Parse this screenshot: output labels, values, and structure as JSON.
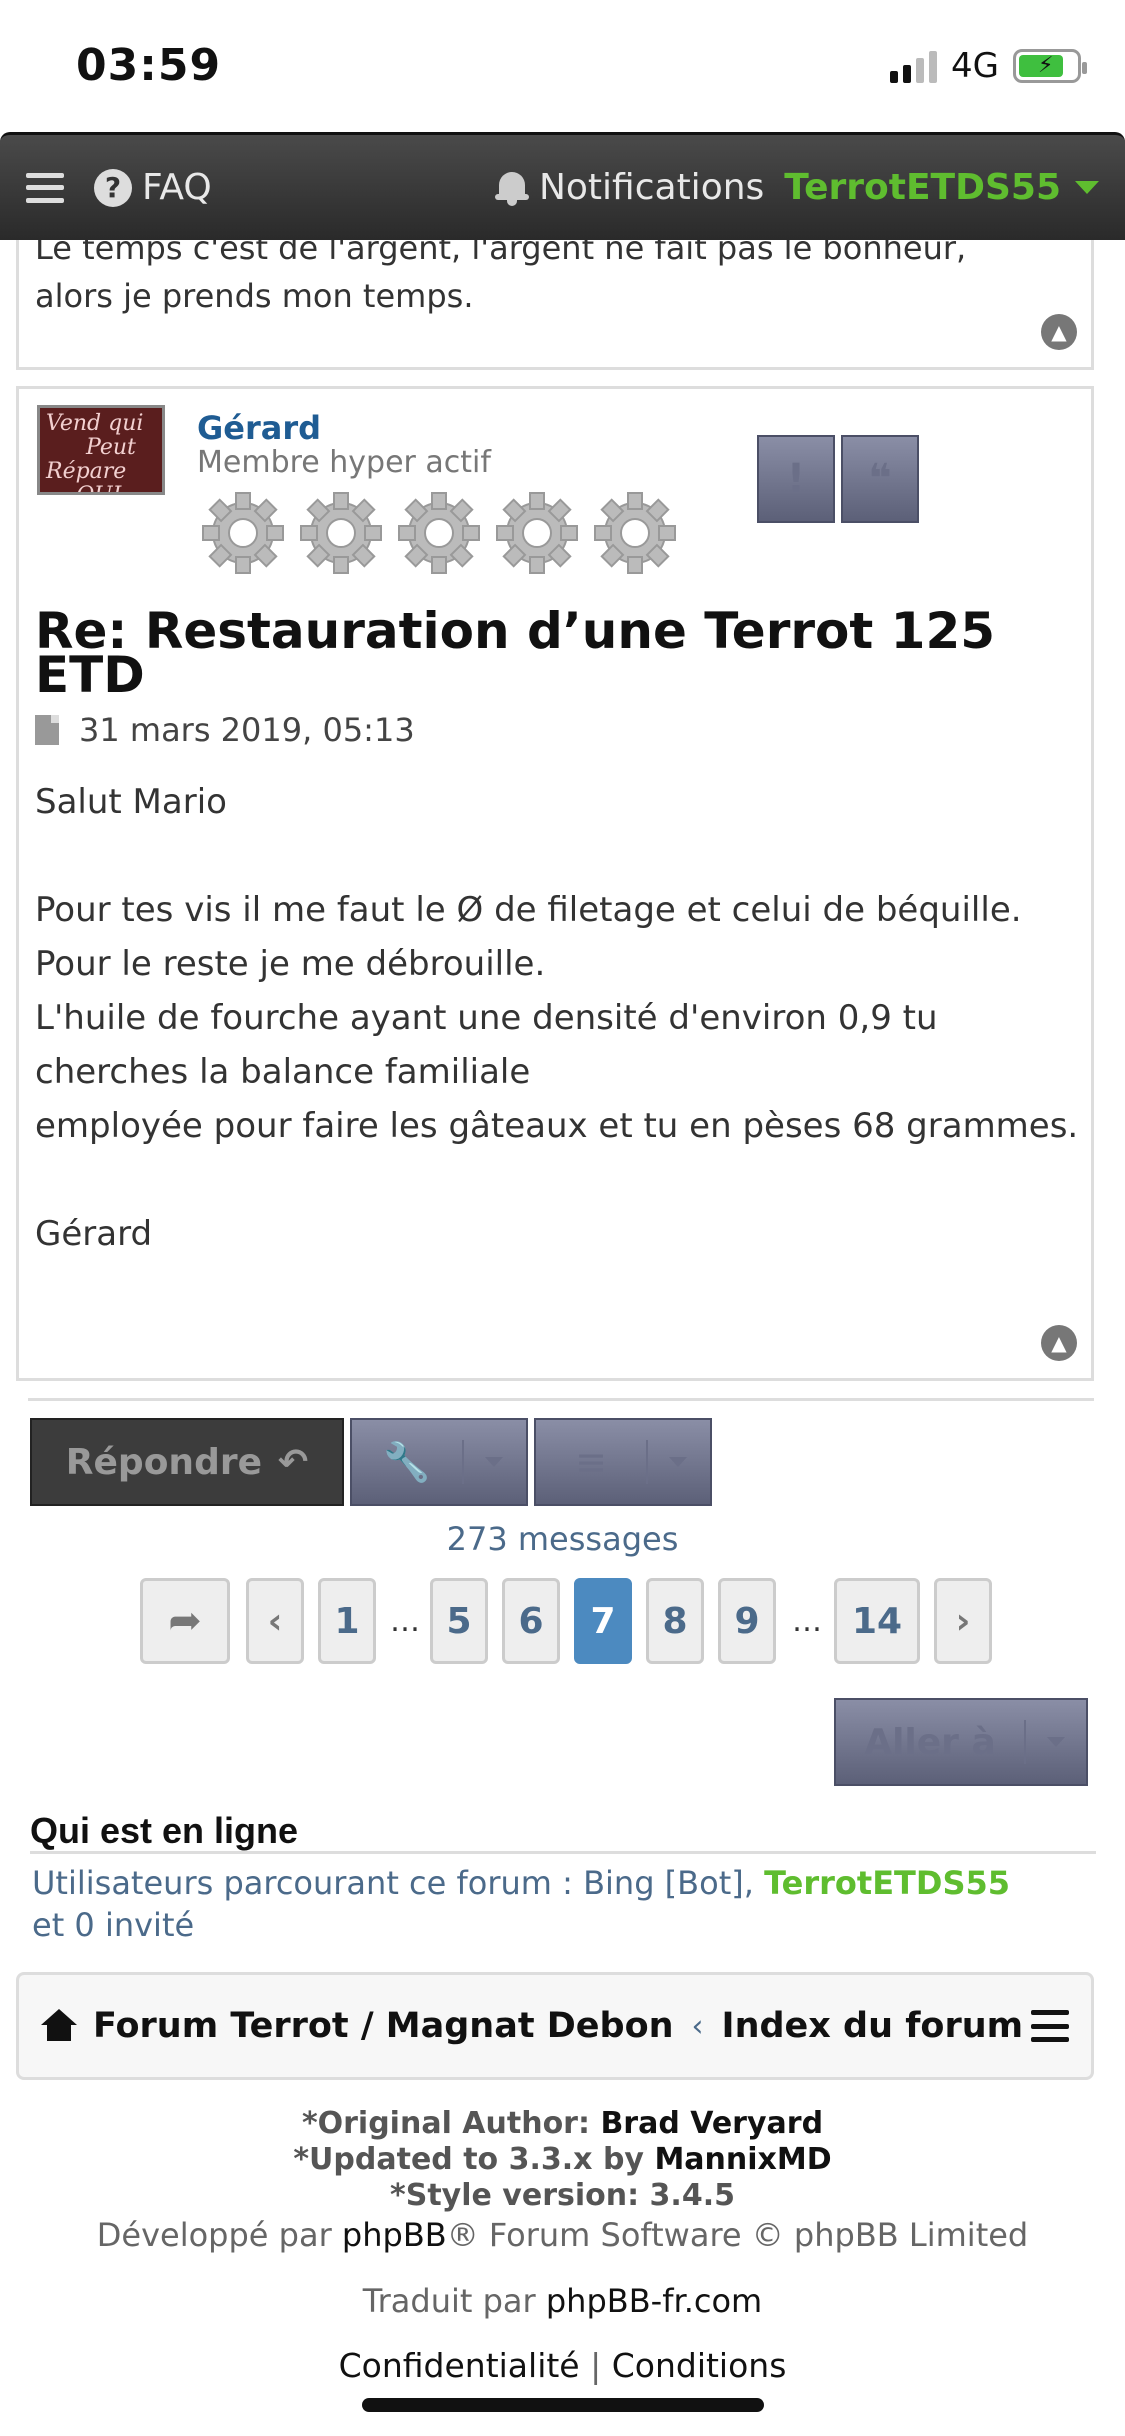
{
  "status_bar": {
    "time": "03:59",
    "network": "4G"
  },
  "navbar": {
    "faq": "FAQ",
    "notifications": "Notifications",
    "username": "TerrotETDS55"
  },
  "prev_post": {
    "text_line1": "Le temps c'est de l'argent, l'argent ne fait pas le bonheur,",
    "text_line2": "alors je prends mon temps."
  },
  "post": {
    "avatar_text": [
      "Vend qui",
      "Peut",
      "Répare",
      "QUI PEUT"
    ],
    "author": "Gérard",
    "rank": "Membre hyper actif",
    "title": "Re: Restauration d’une Terrot 125 ETD",
    "date": "31 mars 2019, 05:13",
    "body": [
      "Salut Mario",
      "",
      "Pour tes vis il me faut le Ø de filetage et celui de béquille.",
      "Pour le reste je me débrouille.",
      "L'huile de fourche ayant une densité d'environ 0,9 tu cherches la balance familiale",
      "employée pour faire les gâteaux et tu en pèses 68 grammes.",
      "",
      "Gérard"
    ]
  },
  "actions": {
    "reply": "Répondre",
    "message_count": "273 messages",
    "goto": "Aller à"
  },
  "pagination": {
    "pages": [
      "1",
      "…",
      "5",
      "6",
      "7",
      "8",
      "9",
      "…",
      "14"
    ],
    "current": "7"
  },
  "online": {
    "title": "Qui est en ligne",
    "prefix": "Utilisateurs parcourant ce forum : Bing [Bot], ",
    "user": "TerrotETDS55",
    "suffix": "et 0 invité"
  },
  "footer_nav": {
    "forum": "Forum Terrot / Magnat Debon",
    "index": "Index du forum"
  },
  "credits": {
    "author_label": "*Original Author:",
    "author": "Brad Veryard",
    "updated_label": "*Updated to 3.3.x by",
    "updated_by": "MannixMD",
    "style_label": "*Style version: 3.4.5",
    "dev_prefix": "Développé par",
    "dev_link": "phpBB",
    "dev_suffix": "® Forum Software © phpBB Limited",
    "trad_prefix": "Traduit par",
    "trad_link": "phpBB-fr.com",
    "privacy": "Confidentialité",
    "terms": "Conditions",
    "sep": "|"
  },
  "colors": {
    "accent_green": "#5fbd2f",
    "link_blue": "#1f5c93",
    "active_page": "#4c8ac0"
  }
}
